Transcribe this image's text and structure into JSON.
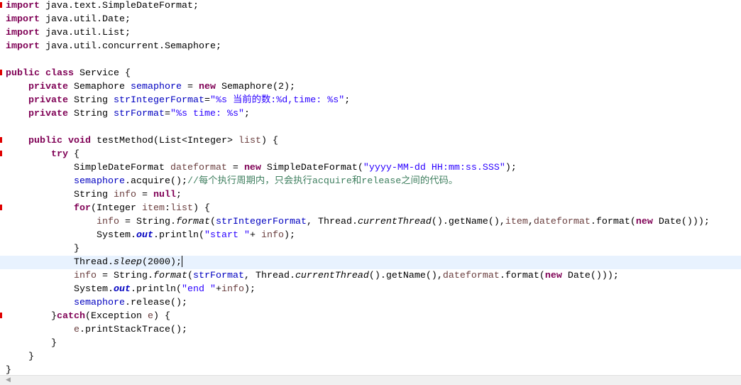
{
  "editor": {
    "current_line": 20,
    "marker_lines": [
      1,
      6,
      11,
      12,
      16,
      24
    ],
    "colors": {
      "keyword": "#7f0055",
      "field": "#0000c0",
      "string": "#2a00ff",
      "comment": "#3f7f5f",
      "local_variable": "#6a3e3e",
      "current_line_bg": "#e8f2fe",
      "marker": "#e00000"
    },
    "lines": [
      [
        [
          "k",
          "import"
        ],
        [
          "p",
          " java.text.SimpleDateFormat;"
        ]
      ],
      [
        [
          "k",
          "import"
        ],
        [
          "p",
          " java.util.Date;"
        ]
      ],
      [
        [
          "k",
          "import"
        ],
        [
          "p",
          " java.util.List;"
        ]
      ],
      [
        [
          "k",
          "import"
        ],
        [
          "p",
          " java.util.concurrent.Semaphore;"
        ]
      ],
      [],
      [
        [
          "k",
          "public"
        ],
        [
          "p",
          " "
        ],
        [
          "k",
          "class"
        ],
        [
          "p",
          " Service {"
        ]
      ],
      [
        [
          "p",
          "    "
        ],
        [
          "k",
          "private"
        ],
        [
          "p",
          " Semaphore "
        ],
        [
          "f",
          "semaphore"
        ],
        [
          "p",
          " = "
        ],
        [
          "k",
          "new"
        ],
        [
          "p",
          " Semaphore(2);"
        ]
      ],
      [
        [
          "p",
          "    "
        ],
        [
          "k",
          "private"
        ],
        [
          "p",
          " String "
        ],
        [
          "f",
          "strIntegerFormat"
        ],
        [
          "p",
          "="
        ],
        [
          "s",
          "\"%s 当前的数:%d,time: %s\""
        ],
        [
          "p",
          ";"
        ]
      ],
      [
        [
          "p",
          "    "
        ],
        [
          "k",
          "private"
        ],
        [
          "p",
          " String "
        ],
        [
          "f",
          "strFormat"
        ],
        [
          "p",
          "="
        ],
        [
          "s",
          "\"%s time: %s\""
        ],
        [
          "p",
          ";"
        ]
      ],
      [],
      [
        [
          "p",
          "    "
        ],
        [
          "k",
          "public"
        ],
        [
          "p",
          " "
        ],
        [
          "k",
          "void"
        ],
        [
          "p",
          " testMethod(List<Integer> "
        ],
        [
          "v",
          "list"
        ],
        [
          "p",
          ") {"
        ]
      ],
      [
        [
          "p",
          "        "
        ],
        [
          "k",
          "try"
        ],
        [
          "p",
          " {"
        ]
      ],
      [
        [
          "p",
          "            SimpleDateFormat "
        ],
        [
          "v",
          "dateformat"
        ],
        [
          "p",
          " = "
        ],
        [
          "k",
          "new"
        ],
        [
          "p",
          " SimpleDateFormat("
        ],
        [
          "s",
          "\"yyyy-MM-dd HH:mm:ss.SSS\""
        ],
        [
          "p",
          ");"
        ]
      ],
      [
        [
          "p",
          "            "
        ],
        [
          "f",
          "semaphore"
        ],
        [
          "p",
          ".acquire();"
        ],
        [
          "c",
          "//每个执行周期内，只会执行acquire和release之间的代码。"
        ]
      ],
      [
        [
          "p",
          "            String "
        ],
        [
          "v",
          "info"
        ],
        [
          "p",
          " = "
        ],
        [
          "k",
          "null"
        ],
        [
          "p",
          ";"
        ]
      ],
      [
        [
          "p",
          "            "
        ],
        [
          "k",
          "for"
        ],
        [
          "p",
          "(Integer "
        ],
        [
          "v",
          "item"
        ],
        [
          "p",
          ":"
        ],
        [
          "v",
          "list"
        ],
        [
          "p",
          ") {"
        ]
      ],
      [
        [
          "p",
          "                "
        ],
        [
          "v",
          "info"
        ],
        [
          "p",
          " = String."
        ],
        [
          "si",
          "format"
        ],
        [
          "p",
          "("
        ],
        [
          "f",
          "strIntegerFormat"
        ],
        [
          "p",
          ", Thread."
        ],
        [
          "si",
          "currentThread"
        ],
        [
          "p",
          "().getName(),"
        ],
        [
          "v",
          "item"
        ],
        [
          "p",
          ","
        ],
        [
          "v",
          "dateformat"
        ],
        [
          "p",
          ".format("
        ],
        [
          "k",
          "new"
        ],
        [
          "p",
          " Date()));"
        ]
      ],
      [
        [
          "p",
          "                System."
        ],
        [
          "sf",
          "out"
        ],
        [
          "p",
          ".println("
        ],
        [
          "s",
          "\"start \""
        ],
        [
          "p",
          "+ "
        ],
        [
          "v",
          "info"
        ],
        [
          "p",
          ");"
        ]
      ],
      [
        [
          "p",
          "            }"
        ]
      ],
      [
        [
          "p",
          "            Thread."
        ],
        [
          "si",
          "sleep"
        ],
        [
          "p",
          "(2000);"
        ]
      ],
      [
        [
          "p",
          "            "
        ],
        [
          "v",
          "info"
        ],
        [
          "p",
          " = String."
        ],
        [
          "si",
          "format"
        ],
        [
          "p",
          "("
        ],
        [
          "f",
          "strFormat"
        ],
        [
          "p",
          ", Thread."
        ],
        [
          "si",
          "currentThread"
        ],
        [
          "p",
          "().getName(),"
        ],
        [
          "v",
          "dateformat"
        ],
        [
          "p",
          ".format("
        ],
        [
          "k",
          "new"
        ],
        [
          "p",
          " Date()));"
        ]
      ],
      [
        [
          "p",
          "            System."
        ],
        [
          "sf",
          "out"
        ],
        [
          "p",
          ".println("
        ],
        [
          "s",
          "\"end \""
        ],
        [
          "p",
          "+"
        ],
        [
          "v",
          "info"
        ],
        [
          "p",
          ");"
        ]
      ],
      [
        [
          "p",
          "            "
        ],
        [
          "f",
          "semaphore"
        ],
        [
          "p",
          ".release();"
        ]
      ],
      [
        [
          "p",
          "        }"
        ],
        [
          "k",
          "catch"
        ],
        [
          "p",
          "(Exception "
        ],
        [
          "v",
          "e"
        ],
        [
          "p",
          ") {"
        ]
      ],
      [
        [
          "p",
          "            "
        ],
        [
          "v",
          "e"
        ],
        [
          "p",
          ".printStackTrace();"
        ]
      ],
      [
        [
          "p",
          "        }"
        ]
      ],
      [
        [
          "p",
          "    }"
        ]
      ],
      [
        [
          "p",
          "}"
        ]
      ]
    ]
  },
  "scrollbar": {
    "left_arrow_icon": "chevron-left-icon"
  }
}
